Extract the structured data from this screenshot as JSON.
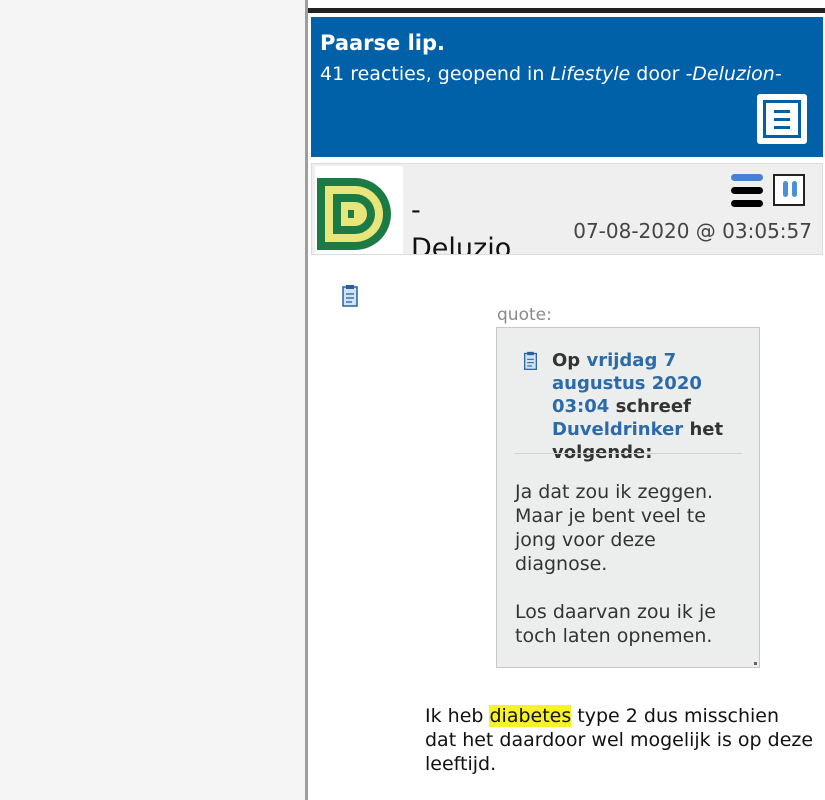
{
  "topic": {
    "title": "Paarse lip.",
    "meta_prefix": "41 reacties, geopend in ",
    "category": "Lifestyle",
    "meta_mid": " door ",
    "author": "-Deluzion-",
    "menu_icon": "hamburger-menu-icon"
  },
  "post": {
    "username": "-Deluzion-",
    "date": "07-08-2020 @ 03:05:57",
    "avatar_icon": "dd-logo-icon",
    "avatar_colors": {
      "green": "#1c7a45",
      "yellow": "#e8e67a"
    },
    "profile_menu_colors": [
      "#4a7fd6",
      "#000000",
      "#000000"
    ],
    "attachment_icon": "document-icon"
  },
  "quote": {
    "label": "quote:",
    "header_prefix": "Op",
    "header_date": "vrijdag 7 augustus 2020 03:04",
    "header_wrote": "schreef",
    "header_user": "Duveldrinker",
    "header_suffix": "het volgende:",
    "icon": "document-icon",
    "paragraphs": [
      "Ja dat zou ik zeggen. Maar je bent veel te jong voor deze diagnose.",
      "Los daarvan zou ik je toch laten opnemen."
    ]
  },
  "reply": {
    "before": "Ik heb ",
    "highlight": "diabetes",
    "after": " type 2 dus misschien dat het daardoor wel mogelijk is op deze leeftijd."
  },
  "colors": {
    "header_blue": "#0060a8",
    "link_blue": "#2d6aa8",
    "highlight_yellow": "#f8f327"
  }
}
